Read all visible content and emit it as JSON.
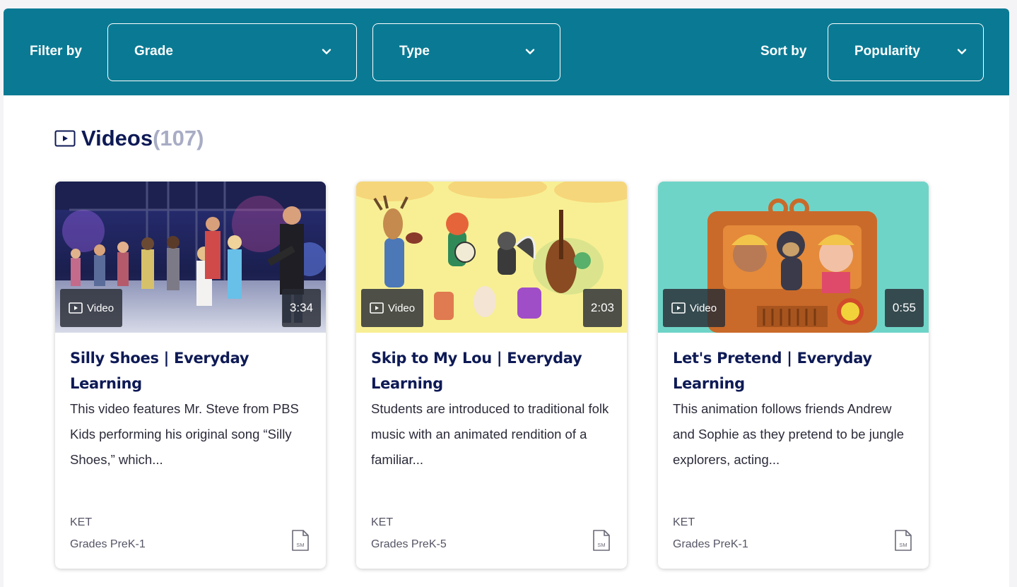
{
  "filter_bar": {
    "filter_label": "Filter by",
    "grade_label": "Grade",
    "type_label": "Type",
    "sort_label": "Sort by",
    "sort_value": "Popularity"
  },
  "section": {
    "title": "Videos",
    "count": "(107)"
  },
  "cards": [
    {
      "badge": "Video",
      "duration": "3:34",
      "title": "Silly Shoes | Everyday Learning",
      "description": "This video features Mr. Steve from PBS Kids performing his original song “Silly Shoes,” which...",
      "source": "KET",
      "grades": "Grades PreK-1",
      "media_icon": "SM"
    },
    {
      "badge": "Video",
      "duration": "2:03",
      "title": "Skip to My Lou | Everyday Learning",
      "description": "Students are introduced to traditional folk music with an animated rendition of a familiar...",
      "source": "KET",
      "grades": "Grades PreK-5",
      "media_icon": "SM"
    },
    {
      "badge": "Video",
      "duration": "0:55",
      "title": "Let's Pretend | Everyday Learning",
      "description": "This animation follows friends Andrew and Sophie as they pretend to be jungle explorers, acting...",
      "source": "KET",
      "grades": "Grades PreK-1",
      "media_icon": "SM"
    }
  ],
  "colors": {
    "filter_bar_bg": "#0a7a94",
    "title_navy": "#0e1a55",
    "count_gray": "#a8acc4"
  },
  "icons": [
    "chevron-down-icon",
    "video-icon",
    "sm-document-icon"
  ]
}
